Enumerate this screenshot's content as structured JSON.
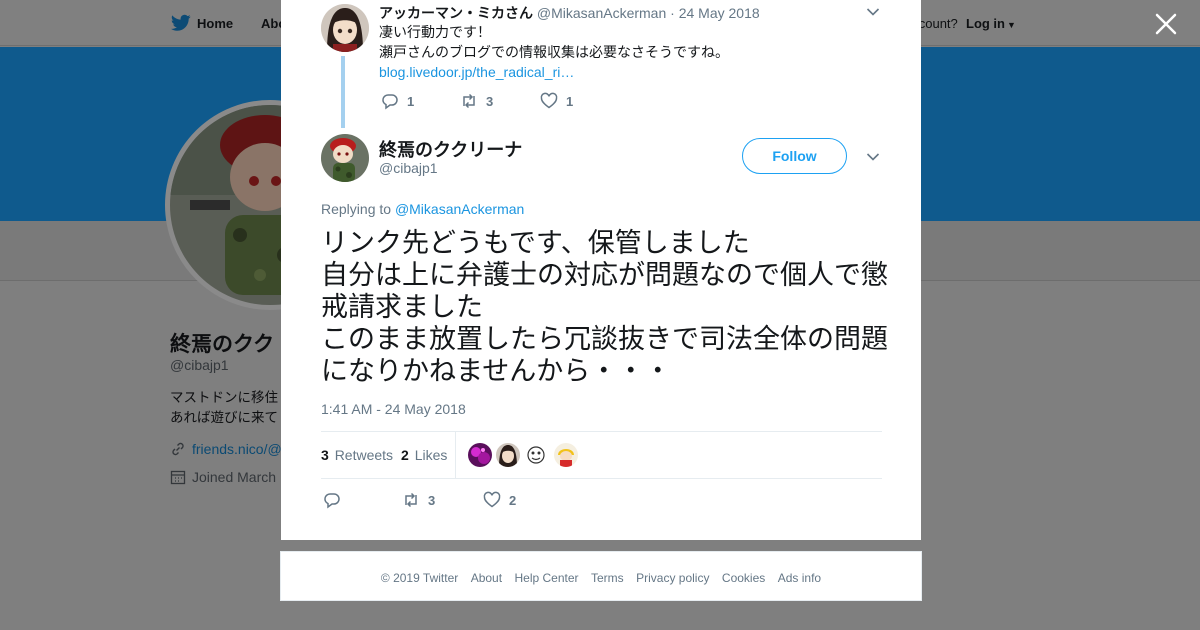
{
  "background": {
    "nav": {
      "home": "Home",
      "about": "Abo",
      "have_account": "account?",
      "login": "Log in"
    },
    "profile": {
      "name": "終焉のクク",
      "handle": "@cibajp1",
      "bio_line1": "マストドンに移住",
      "bio_line2": "あれば遊びに来て",
      "link": "friends.nico/@",
      "joined": "Joined March"
    }
  },
  "parent_tweet": {
    "name": "アッカーマン・ミカさん",
    "handle": "@MikasanAckerman",
    "date": "· 24 May 2018",
    "line1": "凄い行動力です！",
    "line2": "瀬戸さんのブログでの情報収集は必要なさそうですね。",
    "link": "blog.livedoor.jp/the_radical_ri…",
    "replies": "1",
    "retweets": "3",
    "likes": "1"
  },
  "main_tweet": {
    "name": "終焉のククリーナ",
    "handle": "@cibajp1",
    "follow_label": "Follow",
    "replying_prefix": "Replying to ",
    "replying_to": "@MikasanAckerman",
    "text": "リンク先どうもです、保管しました\n自分は上に弁護士の対応が問題なので個人で懲戒請求ました\nこのまま放置したら冗談抜きで司法全体の問題になりかねませんから・・・",
    "timestamp": "1:41 AM - 24 May 2018",
    "retweets_count": "3",
    "retweets_label": "Retweets",
    "likes_count": "2",
    "likes_label": "Likes",
    "action_retweets": "3",
    "action_likes": "2"
  },
  "footer": {
    "copyright": "© 2019 Twitter",
    "links": [
      "About",
      "Help Center",
      "Terms",
      "Privacy policy",
      "Cookies",
      "Ads info"
    ]
  },
  "colors": {
    "accent": "#1da1f2",
    "link": "#1b95e0",
    "muted": "#657786",
    "banner": "#0f5a8d"
  }
}
